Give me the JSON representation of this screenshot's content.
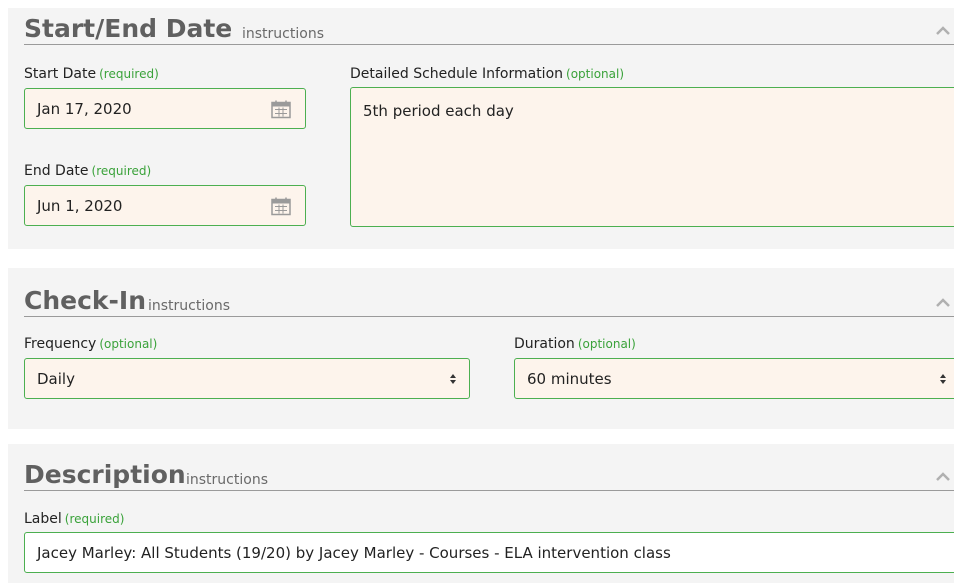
{
  "startEnd": {
    "title": "Start/End Date",
    "instructions": "instructions",
    "startDate": {
      "label": "Start Date",
      "req": "(required)",
      "value": "Jan 17, 2020"
    },
    "endDate": {
      "label": "End Date",
      "req": "(required)",
      "value": "Jun 1, 2020"
    },
    "schedule": {
      "label": "Detailed Schedule Information",
      "req": "(optional)",
      "value": "5th period each day"
    }
  },
  "checkIn": {
    "title": "Check-In",
    "instructions": "instructions",
    "frequency": {
      "label": "Frequency",
      "req": "(optional)",
      "value": "Daily"
    },
    "duration": {
      "label": "Duration",
      "req": "(optional)",
      "value": "60 minutes"
    }
  },
  "description": {
    "title": "Description",
    "instructions": "instructions",
    "labelField": {
      "label": "Label",
      "req": "(required)",
      "value": "Jacey Marley: All Students (19/20) by Jacey Marley - Courses - ELA intervention class"
    }
  },
  "colors": {
    "accent": "#4caf50",
    "required": "#3aa23a",
    "inputBg": "#fdf4ec",
    "panelBg": "#f4f4f4"
  }
}
